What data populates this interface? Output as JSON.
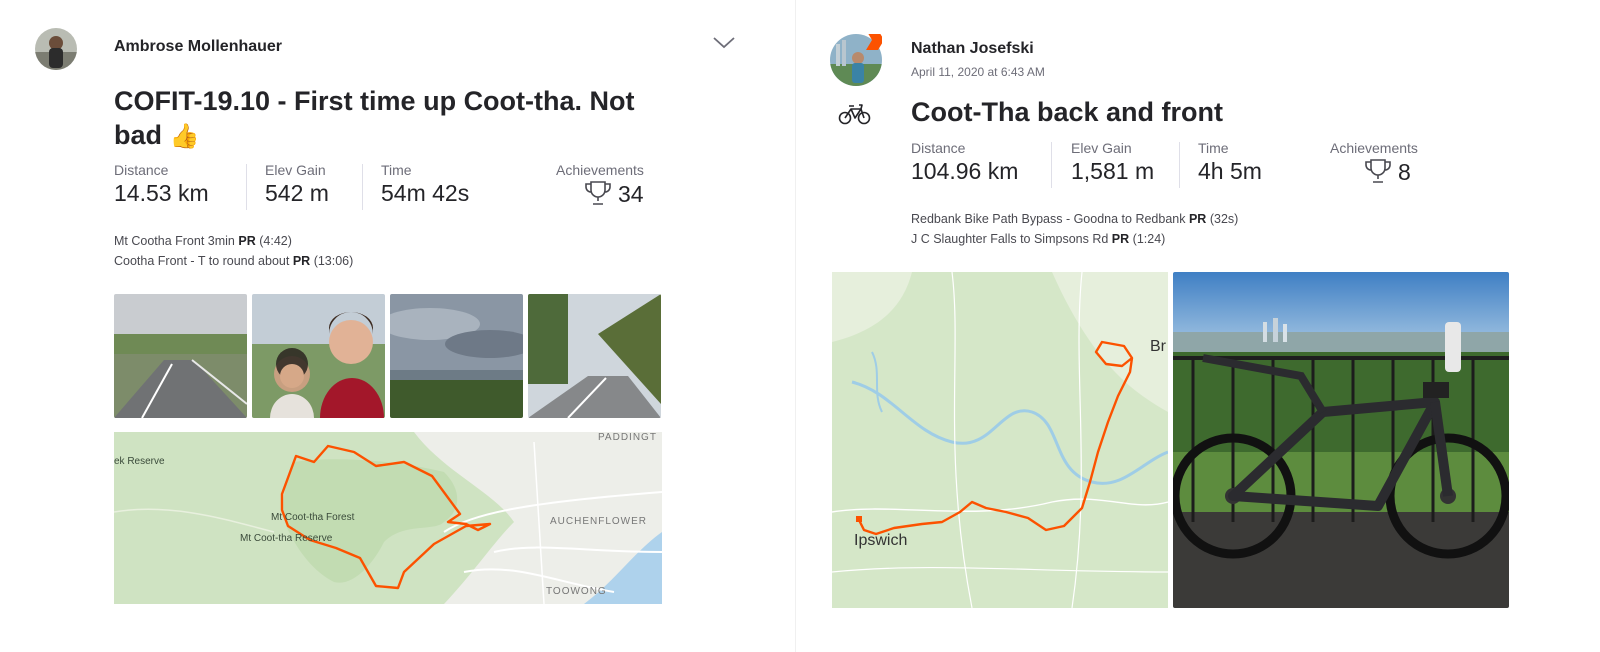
{
  "activities": [
    {
      "athlete": "Ambrose Mollenhauer",
      "title_line1": "COFIT-19.10 - First time up Coot-tha. Not",
      "title_line2": "bad",
      "title_emoji": "👍",
      "stats": {
        "distance_label": "Distance",
        "distance_value": "14.53 km",
        "elev_label": "Elev Gain",
        "elev_value": "542 m",
        "time_label": "Time",
        "time_value": "54m 42s",
        "ach_label": "Achievements",
        "ach_value": "34"
      },
      "segments": [
        {
          "name": "Mt Cootha Front 3min",
          "pr": "PR",
          "time": "(4:42)"
        },
        {
          "name": "Cootha Front - T to round about",
          "pr": "PR",
          "time": "(13:06)"
        }
      ],
      "map_labels": {
        "reserve": "ek Reserve",
        "forest": "Mt Coot-tha Forest",
        "reserve2": "Mt Coot-tha Reserve",
        "padding": "PADDINGT",
        "auchenflower": "AUCHENFLOWER",
        "toowong": "TOOWONG"
      },
      "icons": {
        "menu": "chevron-down-icon",
        "trophy": "trophy-icon"
      }
    },
    {
      "athlete": "Nathan Josefski",
      "date": "April 11, 2020 at 6:43 AM",
      "title": "Coot-Tha back and front",
      "stats": {
        "distance_label": "Distance",
        "distance_value": "104.96 km",
        "elev_label": "Elev Gain",
        "elev_value": "1,581 m",
        "time_label": "Time",
        "time_value": "4h 5m",
        "ach_label": "Achievements",
        "ach_value": "8"
      },
      "segments": [
        {
          "name": "Redbank Bike Path Bypass - Goodna to Redbank",
          "pr": "PR",
          "time": "(32s)"
        },
        {
          "name": "J C Slaughter Falls to Simpsons Rd",
          "pr": "PR",
          "time": "(1:24)"
        }
      ],
      "map_labels": {
        "ipswich": "Ipswich",
        "brisbane": "Br"
      },
      "icons": {
        "sport": "bike-icon",
        "trophy": "trophy-icon"
      }
    }
  ],
  "colors": {
    "route": "#fc5200",
    "map_green": "#cfe3c2",
    "text": "#242428",
    "muted": "#6d6d78"
  }
}
